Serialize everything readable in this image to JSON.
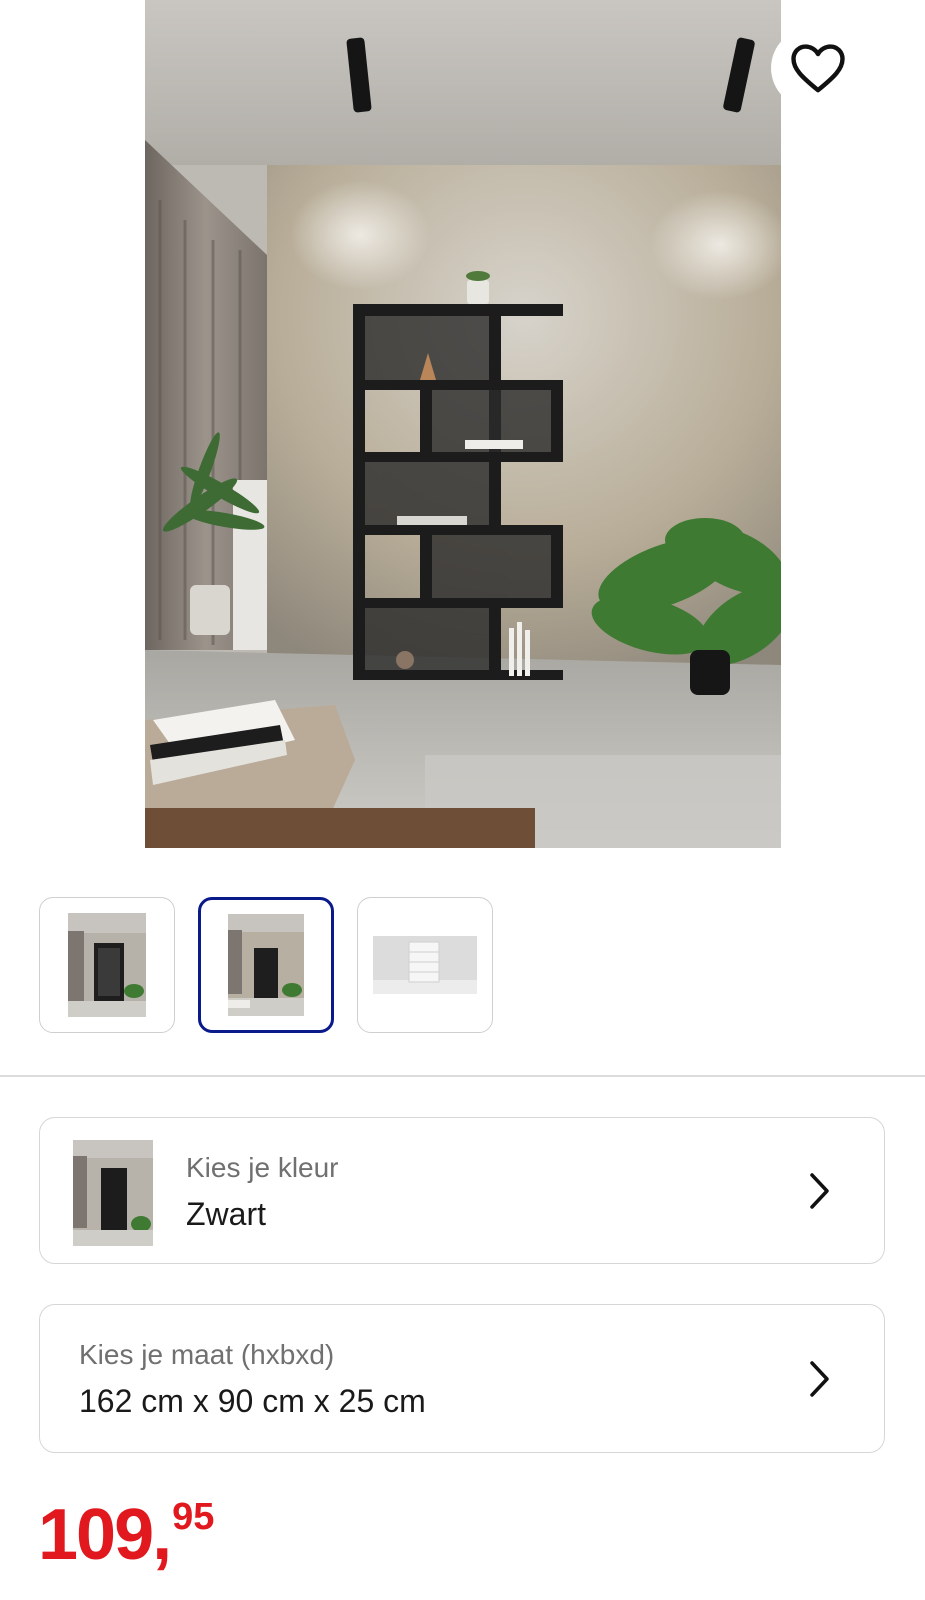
{
  "product": {
    "image_alt": "Zwarte trapvormige boekenkast voor betonnen muur",
    "favorite_icon": "heart-outline-icon"
  },
  "thumbnails": [
    {
      "name": "thumbnail-1",
      "active": false
    },
    {
      "name": "thumbnail-2",
      "active": true
    },
    {
      "name": "thumbnail-3",
      "active": false
    }
  ],
  "options": {
    "color": {
      "label": "Kies je kleur",
      "value": "Zwart"
    },
    "size": {
      "label": "Kies je maat (hxbxd)",
      "value": "162 cm x 90 cm x 25 cm"
    }
  },
  "price": {
    "whole": "109,",
    "cents": "95"
  },
  "colors": {
    "accent_price": "#e1191e",
    "active_border": "#0a1a8a"
  }
}
